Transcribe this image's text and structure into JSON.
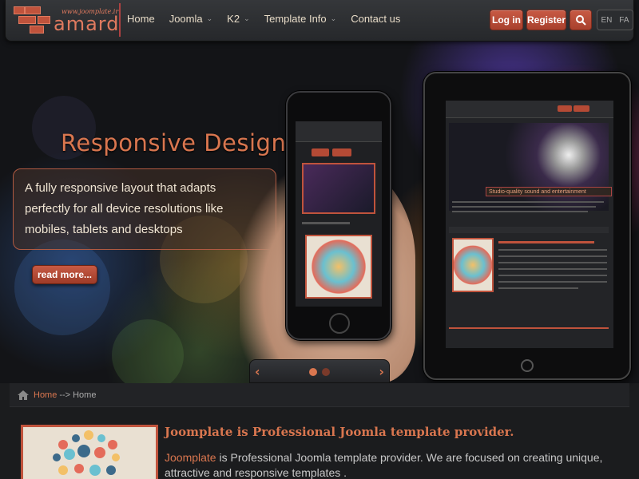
{
  "colors": {
    "accent": "#d9764f",
    "button": "#b44a35",
    "background": "#1b1c1e"
  },
  "header": {
    "logo_url_text": "www.joomplate.ir",
    "logo_word": "amard",
    "nav": [
      {
        "label": "Home",
        "has_dropdown": false
      },
      {
        "label": "Joomla",
        "has_dropdown": true
      },
      {
        "label": "K2",
        "has_dropdown": true
      },
      {
        "label": "Template Info",
        "has_dropdown": true
      },
      {
        "label": "Contact us",
        "has_dropdown": false
      }
    ],
    "login_label": "Log in",
    "register_label": "Register",
    "search_icon": "search-icon",
    "lang_en": "EN",
    "lang_fa": "FA"
  },
  "hero": {
    "title": "Responsive Design",
    "description": "A fully responsive layout that adapts perfectly for all device resolutions like mobiles, tablets and desktops",
    "read_more_label": "read more...",
    "prev_icon": "chevron-left-icon",
    "next_icon": "chevron-right-icon",
    "slide_count": 2,
    "active_slide": 1,
    "tablet_caption": "Studio-quality sound and entertainment"
  },
  "breadcrumb": {
    "home_icon": "home-icon",
    "link": "Home",
    "separator": "-->",
    "current": "Home"
  },
  "article": {
    "title": "Joomplate is Professional Joomla template provider.",
    "brand": "Joomplate",
    "body_rest": " is Professional Joomla template provider. We are focused on creating unique, attractive and responsive templates ."
  }
}
